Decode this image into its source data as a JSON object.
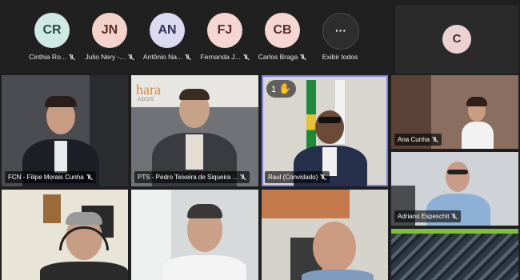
{
  "participants_strip": [
    {
      "initials": "CR",
      "name": "Cinthia Ro...",
      "avatar_bg": "#cfe8e2",
      "avatar_fg": "#244a43"
    },
    {
      "initials": "JN",
      "name": "Julio Nery -...",
      "avatar_bg": "#f3d2cc",
      "avatar_fg": "#5a2b24"
    },
    {
      "initials": "AN",
      "name": "Antônio Na...",
      "avatar_bg": "#dcdaf0",
      "avatar_fg": "#33305a"
    },
    {
      "initials": "FJ",
      "name": "Fernanda J...",
      "avatar_bg": "#f5d6d3",
      "avatar_fg": "#5a2c28"
    },
    {
      "initials": "CB",
      "name": "Carlos Braga",
      "avatar_bg": "#f5d6d3",
      "avatar_fg": "#5a2c28"
    }
  ],
  "show_all": {
    "glyph": "···",
    "label": "Exibir todos"
  },
  "spotlight": {
    "initials": "C"
  },
  "tiles": {
    "filipe": {
      "name": "FCN - Filipe Morais Cunha"
    },
    "pedro": {
      "name": "PTS - Pedro Teixeira de Siqueira ...",
      "logo_text": "hara",
      "logo_sub": "ADOS"
    },
    "raul": {
      "name": "Raul (Convidado)",
      "hand_count": "1",
      "hand_icon": "raised-hand-icon"
    },
    "ana": {
      "name": "Ana Cunha"
    },
    "adriano": {
      "name": "Adriano Espeschit"
    }
  },
  "colors": {
    "accent": "#7b83eb",
    "raised_hand": "#f5c542"
  }
}
